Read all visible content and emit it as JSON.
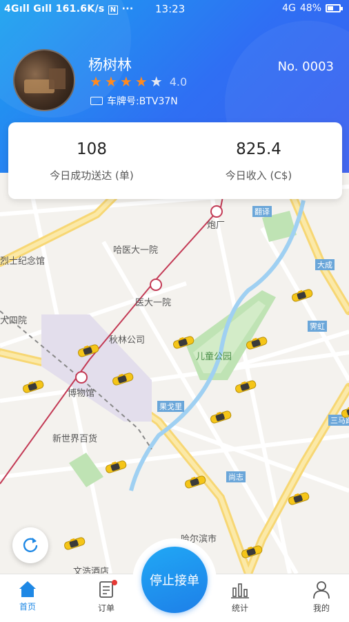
{
  "status_bar": {
    "signal": "4Gıll Gıll 161.6K/s",
    "sim_icon": "N",
    "dots": "···",
    "time": "13:23",
    "network": "4G",
    "battery": "48%",
    "battery_level": 0.48
  },
  "profile": {
    "name": "杨树林",
    "rating": "4.0",
    "stars_filled": 4,
    "stars_total": 5,
    "plate_label": "车牌号:BTV37N",
    "number": "No. 0003"
  },
  "stats": [
    {
      "value": "108",
      "label": "今日成功送达 (单)"
    },
    {
      "value": "825.4",
      "label": "今日收入 (C$)"
    }
  ],
  "map": {
    "labels": [
      "哈医大一院",
      "烈士纪念馆",
      "医大一院",
      "大四院",
      "秋林公司",
      "儿童公园",
      "博物馆",
      "果戈里",
      "新世界百货",
      "大成",
      "霁虹",
      "哈尔滨市",
      "文浩酒店",
      "炮厂",
      "翻译",
      "尚志",
      "三马路"
    ]
  },
  "buttons": {
    "stop": "停止接单"
  },
  "tabs": [
    {
      "label": "首页",
      "icon": "home-icon",
      "active": true
    },
    {
      "label": "订单",
      "icon": "order-icon",
      "active": false
    },
    {
      "label": "统计",
      "icon": "stats-icon",
      "active": false
    },
    {
      "label": "我的",
      "icon": "profile-icon",
      "active": false
    }
  ],
  "colors": {
    "accent": "#1e88e5",
    "header_start": "#1aa3f0",
    "header_end": "#3a5ff0",
    "star": "#ff8a1f",
    "taxi": "#f5c518"
  }
}
